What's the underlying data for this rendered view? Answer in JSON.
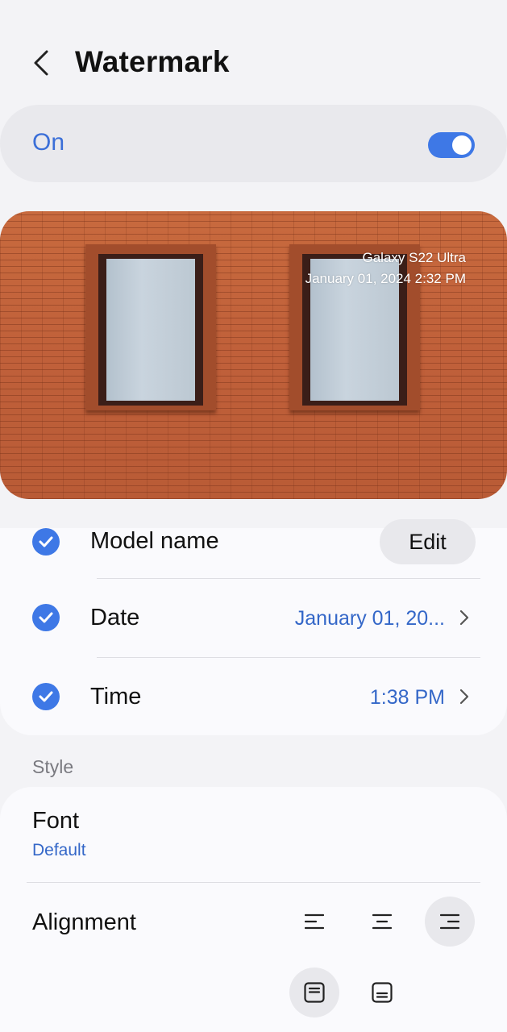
{
  "header": {
    "title": "Watermark"
  },
  "master_toggle": {
    "label": "On",
    "state": "on",
    "accent_color": "#3e78e6"
  },
  "preview": {
    "watermark_line1": "Galaxy S22 Ultra",
    "watermark_line2": "January 01, 2024 2:32 PM"
  },
  "options": {
    "model_name": {
      "label": "Model name",
      "checked": true,
      "action_label": "Edit"
    },
    "date": {
      "label": "Date",
      "checked": true,
      "value": "January 01, 20..."
    },
    "time": {
      "label": "Time",
      "checked": true,
      "value": "1:38 PM"
    }
  },
  "style": {
    "section_title": "Style",
    "font": {
      "label": "Font",
      "value": "Default"
    },
    "alignment": {
      "label": "Alignment",
      "options": [
        "align-left",
        "align-center",
        "align-right"
      ],
      "selected": "align-right"
    },
    "position": {
      "options": [
        "position-top",
        "position-bottom"
      ],
      "selected": "position-top"
    }
  }
}
